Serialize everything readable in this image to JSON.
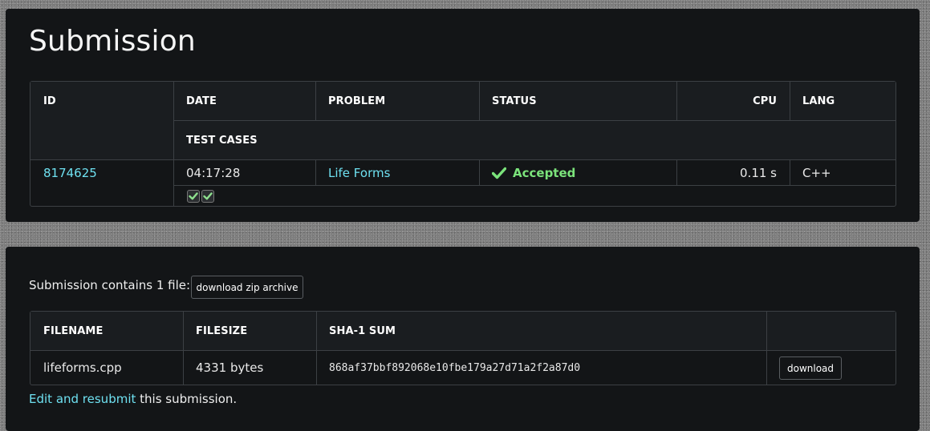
{
  "page": {
    "title": "Submission"
  },
  "submission_table": {
    "headers": {
      "id": "ID",
      "date": "DATE",
      "problem": "PROBLEM",
      "status": "STATUS",
      "cpu": "CPU",
      "lang": "LANG",
      "test_cases": "TEST CASES"
    },
    "row": {
      "id": "8174625",
      "date": "04:17:28",
      "problem": "Life Forms",
      "status": "Accepted",
      "status_icon": "check-icon",
      "cpu": "0.11 s",
      "lang": "C++",
      "test_cases": [
        "passed",
        "passed"
      ]
    }
  },
  "files": {
    "summary": "Submission contains 1 file:",
    "download_zip_label": "download zip archive",
    "headers": {
      "filename": "FILENAME",
      "filesize": "FILESIZE",
      "sha1": "SHA-1 SUM"
    },
    "rows": [
      {
        "filename": "lifeforms.cpp",
        "filesize": "4331 bytes",
        "sha1": "868af37bbf892068e10fbe179a27d71a2f2a87d0",
        "download_label": "download"
      }
    ]
  },
  "footer": {
    "edit_link": "Edit and resubmit",
    "edit_suffix": " this submission."
  },
  "colors": {
    "link": "#6ee0f0",
    "accepted": "#7be37b",
    "card_bg": "#131517",
    "border": "#3c4044"
  }
}
